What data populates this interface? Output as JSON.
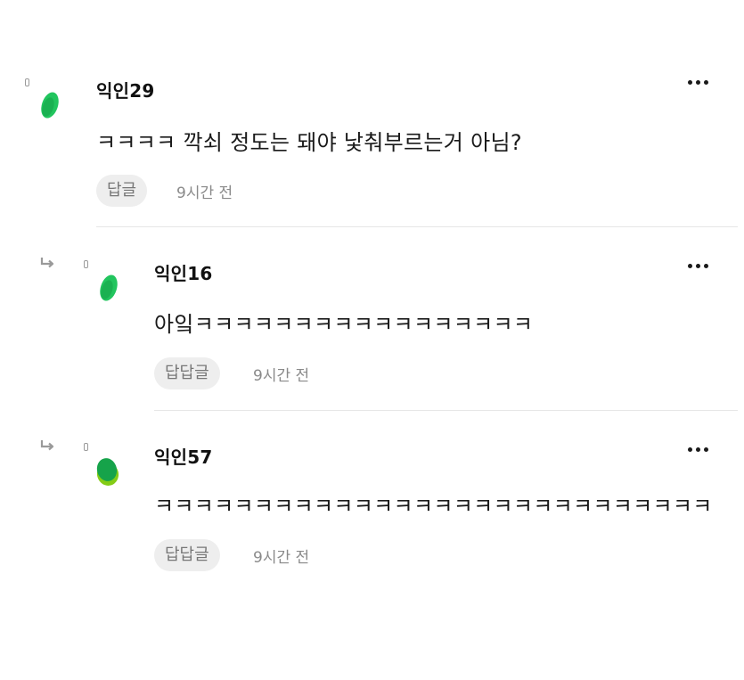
{
  "comments": [
    {
      "author": "익인29",
      "text": "ㅋㅋㅋㅋ 깍쇠 정도는 돼야 낯춰부르는거 아님?",
      "reply_label": "답글",
      "time": "9시간 전",
      "more_icon": "more-horizontal-icon",
      "avatar_color": "#22c55e"
    },
    {
      "author": "익인16",
      "text": "아잌ㅋㅋㅋㅋㅋㅋㅋㅋㅋㅋㅋㅋㅋㅋㅋㅋㅋ",
      "reply_label": "답답글",
      "time": "9시간 전",
      "more_icon": "more-horizontal-icon",
      "avatar_color": "#22c55e"
    },
    {
      "author": "익인57",
      "text": "ㅋㅋㅋㅋㅋㅋㅋㅋㅋㅋㅋㅋㅋㅋㅋㅋㅋㅋㅋㅋㅋㅋㅋㅋㅋㅋㅋㅋ",
      "reply_label": "답답글",
      "time": "9시간 전",
      "more_icon": "more-horizontal-icon",
      "avatar_color": "#16a34a"
    }
  ]
}
